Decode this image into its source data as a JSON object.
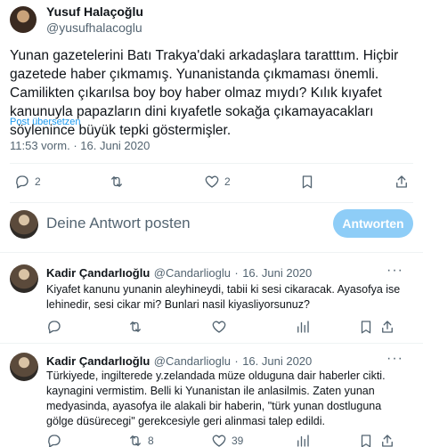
{
  "main_tweet": {
    "author_name": "Yusuf Halaçoğlu",
    "author_handle": "@yusufhalacoglu",
    "text": "Yunan gazetelerini Batı Trakya'daki arkadaşlara taratttım. Hiçbir gazetede haber çıkmamış. Yunanistanda çıkmaması önemli. Camilikten çıkarılsa boy boy haber olmaz mıydı? Kılık kıyafet kanunuyla papazların dini kıyafetle sokağa çıkamayacakları söylenince büyük tepki göstermişler.",
    "translate_label": "Post übersetzen",
    "time": "11:53 vorm.",
    "date_sep": "·",
    "date": "16. Juni 2020",
    "actions": {
      "replies": "2",
      "retweets": "",
      "likes": "2"
    }
  },
  "compose": {
    "placeholder": "Deine Antwort posten",
    "button_label": "Antworten"
  },
  "replies": [
    {
      "name": "Kadir Çandarlıoğlu",
      "handle": "@Candarlioglu",
      "sep": "·",
      "date": "16. Juni 2020",
      "more": "···",
      "text": "Kiyafet kanunu yunanin aleyhineydi, tabii ki sesi cikaracak. Ayasofya ise lehinedir, sesi cikar mi? Bunlari nasil kiyasliyorsunuz?",
      "actions": {
        "replies": "",
        "retweets": "",
        "likes": "",
        "views": ""
      }
    },
    {
      "name": "Kadir Çandarlıoğlu",
      "handle": "@Candarlioglu",
      "sep": "·",
      "date": "16. Juni 2020",
      "more": "···",
      "text": "Türkiyede, ingilterede y.zelandada müze olduguna dair haberler cikti. kaynagini vermistim. Belli ki Yunanistan ile anlasilmis. Zaten yunan medyasinda, ayasofya ile alakali bir haberin, \"türk yunan dostluguna gölge düsürecegi\" gerekcesiyle geri alinmasi talep edildi.",
      "actions": {
        "replies": "",
        "retweets": "8",
        "likes": "39",
        "views": ""
      }
    }
  ]
}
